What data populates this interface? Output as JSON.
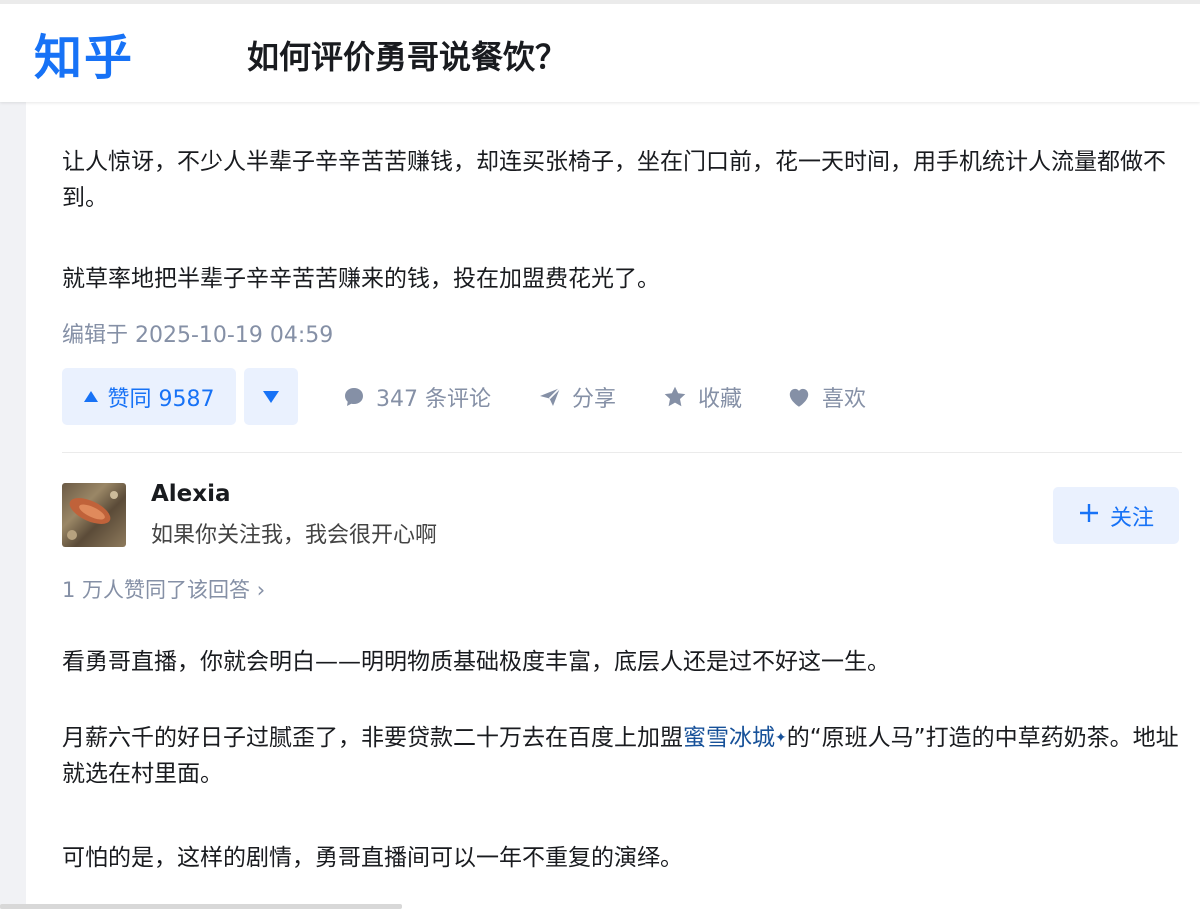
{
  "header": {
    "logo": "知乎",
    "question_title": "如何评价勇哥说餐饮？"
  },
  "answer_top": {
    "paragraphs": [
      "让人惊讶，不少人半辈子辛辛苦苦赚钱，却连买张椅子，坐在门口前，花一天时间，用手机统计人流量都做不到。",
      "就草率地把半辈子辛辛苦苦赚来的钱，投在加盟费花光了。"
    ],
    "edited": "编辑于 2025-10-19 04:59",
    "vote_up": "赞同 9587",
    "actions": {
      "comments": "347 条评论",
      "share": "分享",
      "collect": "收藏",
      "like": "喜欢"
    }
  },
  "answer_next": {
    "author": {
      "name": "Alexia",
      "bio": "如果你关注我，我会很开心啊"
    },
    "follow_label": "关注",
    "likers": "1 万人赞同了该回答 ›",
    "p1": "看勇哥直播，你就会明白——明明物质基础极度丰富，底层人还是过不好这一生。",
    "p2_before": "月薪六千的好日子过腻歪了，非要贷款二十万去在百度上加盟",
    "p2_link": "蜜雪冰城",
    "p2_after": "的“原班人马”打造的中草药奶茶。地址就选在村里面。",
    "p3": "可怕的是，这样的剧情，勇哥直播间可以一年不重复的演绎。"
  },
  "colors": {
    "brand": "#1772f6",
    "muted": "#8590a6",
    "link": "#175199",
    "button_bg": "#eaf1fe"
  },
  "icons": [
    "comment-icon",
    "share-icon",
    "star-icon",
    "heart-icon",
    "plus-icon",
    "link-sparkle-icon"
  ]
}
